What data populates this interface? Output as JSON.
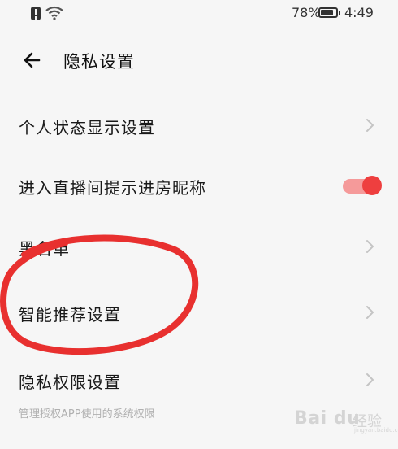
{
  "status_bar": {
    "battery_percent": "78%",
    "battery_level": 0.78,
    "time": "4:49",
    "icons": [
      "alert-icon",
      "wifi-icon",
      "battery-icon"
    ]
  },
  "header": {
    "title": "隐私设置",
    "back_icon": "arrow-left-icon"
  },
  "settings": [
    {
      "label": "个人状态显示设置",
      "control": "chevron"
    },
    {
      "label": "进入直播间提示进房昵称",
      "control": "toggle",
      "toggle_on": true
    },
    {
      "label": "黑名单",
      "control": "chevron"
    },
    {
      "label": "智能推荐设置",
      "control": "chevron"
    },
    {
      "label": "隐私权限设置",
      "control": "chevron",
      "sublabel": "管理授权APP使用的系统权限"
    }
  ],
  "annotation": {
    "shape": "ellipse",
    "color": "#e8302f",
    "target": "智能推荐设置"
  },
  "colors": {
    "toggle_knob": "#ee3f3f",
    "toggle_track": "#f59a9a",
    "background": "#f6f6f6"
  },
  "watermark": {
    "logo_text": "Bai du",
    "cn_text": "经验",
    "url_text": "jingyan.baidu.com"
  }
}
